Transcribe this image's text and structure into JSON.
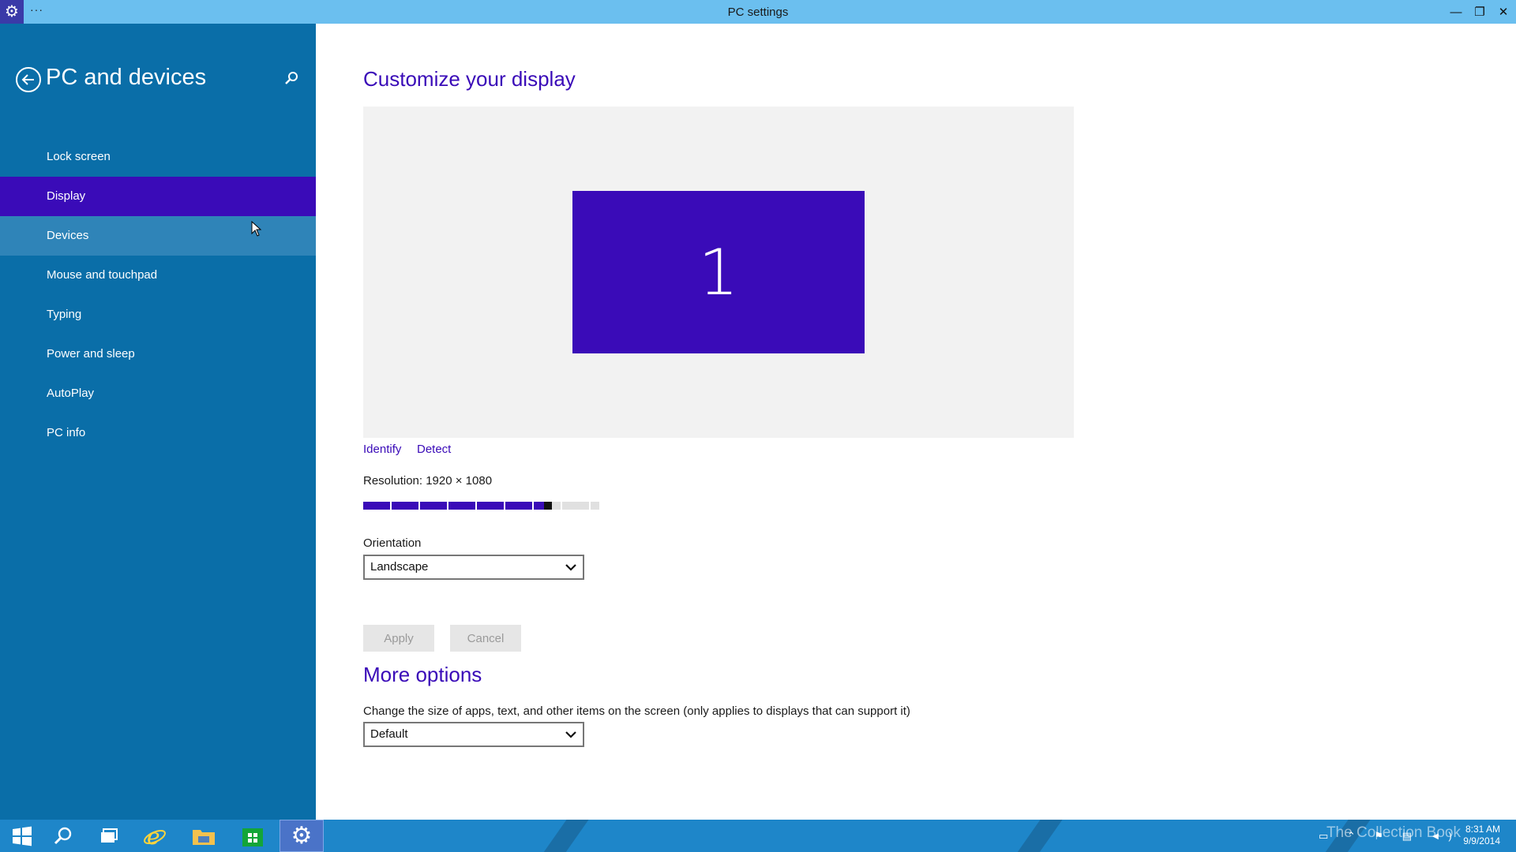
{
  "window": {
    "title": "PC settings",
    "more_label": "···",
    "app_icon": "gear-icon",
    "controls": {
      "minimize": "—",
      "restore": "❐",
      "close": "✕"
    }
  },
  "nav": {
    "title": "PC and devices",
    "back_icon": "back-arrow-icon",
    "search_icon": "search-icon",
    "items": [
      {
        "label": "Lock screen"
      },
      {
        "label": "Display"
      },
      {
        "label": "Devices"
      },
      {
        "label": "Mouse and touchpad"
      },
      {
        "label": "Typing"
      },
      {
        "label": "Power and sleep"
      },
      {
        "label": "AutoPlay"
      },
      {
        "label": "PC info"
      }
    ],
    "selected": "Display",
    "hovered": "Devices"
  },
  "main": {
    "title": "Customize your display",
    "monitor_number": "1",
    "identify_label": "Identify",
    "detect_label": "Detect",
    "resolution_label": "Resolution: 1920 × 1080",
    "resolution_slider": {
      "position": 0.8
    },
    "orientation_label": "Orientation",
    "orientation_value": "Landscape",
    "apply_label": "Apply",
    "cancel_label": "Cancel",
    "more_options_title": "More options",
    "scaling_label": "Change the size of apps, text, and other items on the screen (only applies to displays that can support it)",
    "scaling_value": "Default"
  },
  "taskbar": {
    "items": [
      {
        "name": "start-button",
        "icon": "windows-logo-icon"
      },
      {
        "name": "search-button",
        "icon": "search-icon"
      },
      {
        "name": "task-view-button",
        "icon": "task-view-icon"
      },
      {
        "name": "internet-explorer",
        "icon": "ie-icon"
      },
      {
        "name": "file-explorer",
        "icon": "folder-icon"
      },
      {
        "name": "store",
        "icon": "store-icon"
      },
      {
        "name": "pc-settings",
        "icon": "gear-icon",
        "active": true
      }
    ],
    "watermark": "The Collection Book",
    "time": "8:31 AM",
    "date": "9/9/2014"
  },
  "colors": {
    "accent": "#3a0bb8",
    "nav_background": "#0a6ea8",
    "titlebar": "#6bbfef",
    "taskbar": "#1e86c9"
  }
}
